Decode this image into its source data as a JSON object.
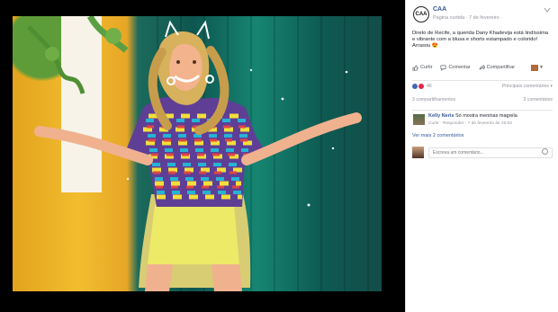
{
  "post": {
    "page_initials": "CAA",
    "page_name": "CAA",
    "meta": "Página curtida · 7 de fevereiro · ",
    "text": "Direto de Recife, a querida Dany Khadevija está lindíssima e vibrante com a blusa e shorts estampado e colorido! Arrasou 😍",
    "actions": [
      "Curtir",
      "Comentar",
      "Compartilhar"
    ],
    "reaction_count": "46",
    "sort_label": "Principais comentários ▾",
    "shares": "3 compartilhamentos",
    "comments_count": "3 comentários",
    "more_comments": "Ver mais 2 comentários"
  },
  "comment": {
    "name": "Kelly Neris",
    "text": "Só mostra meninas magrela",
    "actions": "Curtir · Responder · 7 de fevereiro às 15:53"
  },
  "composer": {
    "placeholder": "Escreva um comentário..."
  },
  "icons": {
    "like": "like-icon",
    "comment": "comment-icon",
    "share": "share-icon",
    "emoji": "emoji-icon"
  }
}
